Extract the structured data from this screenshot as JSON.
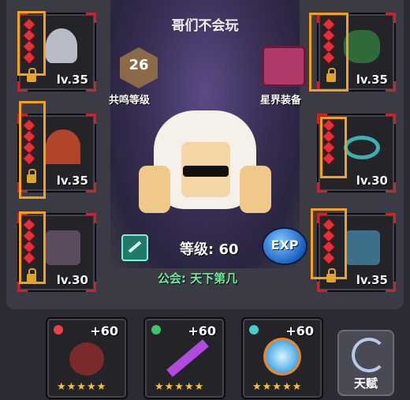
{
  "header": {
    "title": "哥们不会玩"
  },
  "badges": {
    "resonance": {
      "value": "26",
      "label": "共鸣等级"
    },
    "astral_gear": {
      "label": "星界装备"
    }
  },
  "hero": {
    "level_label": "等级: 60",
    "guild_label": "公会: 天下第几",
    "exp_label": "EXP"
  },
  "equipment": {
    "left": [
      {
        "level": "lv.35",
        "locked": true,
        "icon": "helmet-icon"
      },
      {
        "level": "lv.35",
        "locked": true,
        "icon": "cape-icon"
      },
      {
        "level": "lv.30",
        "locked": true,
        "icon": "armor-icon"
      }
    ],
    "right": [
      {
        "level": "lv.35",
        "locked": true,
        "icon": "amulet-icon"
      },
      {
        "level": "lv.30",
        "locked": false,
        "icon": "ring-icon"
      },
      {
        "level": "lv.35",
        "locked": true,
        "icon": "boots-icon"
      }
    ]
  },
  "weapons": [
    {
      "bonus": "+60",
      "stars": "★★★★★",
      "icon": "crossbow-icon",
      "gem_color": "#e8434a"
    },
    {
      "bonus": "+60",
      "stars": "★★★★★",
      "icon": "staff-icon",
      "gem_color": "#3fc66a"
    },
    {
      "bonus": "+60",
      "stars": "★★★★★",
      "icon": "orb-icon",
      "gem_color": "#3fd0d0"
    }
  ],
  "talent": {
    "label": "天赋",
    "icon": "talent-icon"
  },
  "colors": {
    "highlight": "#f3a01b",
    "slot_border": "#c8252c",
    "guild": "#6cf0a0"
  }
}
